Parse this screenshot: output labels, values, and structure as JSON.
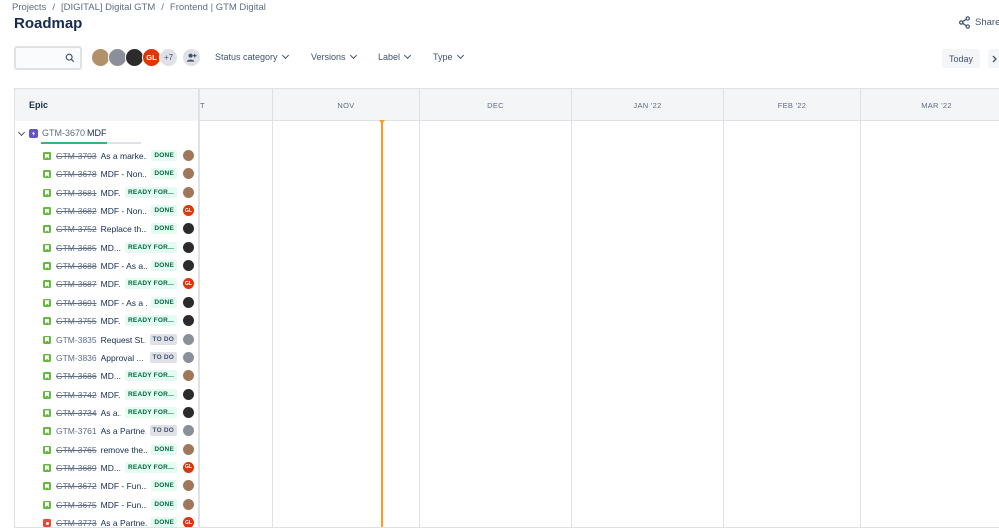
{
  "breadcrumb": {
    "items": [
      "Projects",
      "[DIGITAL] Digital GTM",
      "Frontend | GTM Digital"
    ],
    "separator": "/"
  },
  "page": {
    "title": "Roadmap",
    "share_label": "Share"
  },
  "toolbar": {
    "search_placeholder": "",
    "more_avatars_label": "+7",
    "filters": [
      "Status category",
      "Versions",
      "Label",
      "Type"
    ],
    "today_label": "Today"
  },
  "avatars": [
    {
      "initials": "",
      "color": "#b0916a"
    },
    {
      "initials": "",
      "color": "#8a8f99"
    },
    {
      "initials": "",
      "color": "#2b2b2b"
    },
    {
      "initials": "GL",
      "color": "#de350b"
    }
  ],
  "timeline": {
    "epic_column_label": "Epic",
    "months": [
      "T",
      "NOV",
      "DEC",
      "JAN '22",
      "FEB '22",
      "MAR '22"
    ]
  },
  "epic": {
    "key": "GTM-3670",
    "name": "MDF",
    "progress": 0.66
  },
  "colors": {
    "done_avatar": "#a1887f",
    "today_line": "#ff991f"
  },
  "issues": [
    {
      "key": "GTM-3703",
      "summary": "As a marke...",
      "status": "DONE",
      "type": "story",
      "avatar": "#a1775b",
      "av_text": ""
    },
    {
      "key": "GTM-3678",
      "summary": "MDF - Non...",
      "status": "DONE",
      "type": "story",
      "avatar": "#a1775b",
      "av_text": ""
    },
    {
      "key": "GTM-3681",
      "summary": "MDF...",
      "status": "READY FOR...",
      "type": "story",
      "avatar": "#a1775b",
      "av_text": ""
    },
    {
      "key": "GTM-3682",
      "summary": "MDF - Non...",
      "status": "DONE",
      "type": "story",
      "avatar": "#de350b",
      "av_text": "GL"
    },
    {
      "key": "GTM-3752",
      "summary": "Replace th...",
      "status": "DONE",
      "type": "story",
      "avatar": "#2b2b2b",
      "av_text": ""
    },
    {
      "key": "GTM-3685",
      "summary": "MD...",
      "status": "READY FOR...",
      "type": "story",
      "avatar": "#2b2b2b",
      "av_text": ""
    },
    {
      "key": "GTM-3688",
      "summary": "MDF - As a...",
      "status": "DONE",
      "type": "story",
      "avatar": "#2b2b2b",
      "av_text": ""
    },
    {
      "key": "GTM-3687",
      "summary": "MDF...",
      "status": "READY FOR...",
      "type": "story",
      "avatar": "#de350b",
      "av_text": "GL"
    },
    {
      "key": "GTM-3691",
      "summary": "MDF - As a ...",
      "status": "DONE",
      "type": "story",
      "avatar": "#2b2b2b",
      "av_text": ""
    },
    {
      "key": "GTM-3755",
      "summary": "MDF...",
      "status": "READY FOR...",
      "type": "story",
      "avatar": "#2b2b2b",
      "av_text": ""
    },
    {
      "key": "GTM-3835",
      "summary": "Request St...",
      "status": "TO DO",
      "type": "story",
      "avatar": "#8a8f99",
      "av_text": ""
    },
    {
      "key": "GTM-3836",
      "summary": "Approval ...",
      "status": "TO DO",
      "type": "story",
      "avatar": "#8a8f99",
      "av_text": ""
    },
    {
      "key": "GTM-3686",
      "summary": "MD...",
      "status": "READY FOR...",
      "type": "story",
      "avatar": "#a1775b",
      "av_text": ""
    },
    {
      "key": "GTM-3742",
      "summary": "MDF...",
      "status": "READY FOR...",
      "type": "story",
      "avatar": "#2b2b2b",
      "av_text": ""
    },
    {
      "key": "GTM-3734",
      "summary": "As a...",
      "status": "READY FOR...",
      "type": "story",
      "avatar": "#2b2b2b",
      "av_text": ""
    },
    {
      "key": "GTM-3761",
      "summary": "As a Partne...",
      "status": "TO DO",
      "type": "story",
      "avatar": "#8a8f99",
      "av_text": ""
    },
    {
      "key": "GTM-3765",
      "summary": "remove the...",
      "status": "DONE",
      "type": "story",
      "avatar": "#a1775b",
      "av_text": ""
    },
    {
      "key": "GTM-3689",
      "summary": "MD...",
      "status": "READY FOR...",
      "type": "story",
      "avatar": "#de350b",
      "av_text": "GL"
    },
    {
      "key": "GTM-3672",
      "summary": "MDF - Fun...",
      "status": "DONE",
      "type": "story",
      "avatar": "#a1775b",
      "av_text": ""
    },
    {
      "key": "GTM-3675",
      "summary": "MDF - Fun...",
      "status": "DONE",
      "type": "story",
      "avatar": "#a1775b",
      "av_text": ""
    },
    {
      "key": "GTM-3773",
      "summary": "As a Partne...",
      "status": "DONE",
      "type": "bug",
      "avatar": "#de350b",
      "av_text": "GL"
    }
  ]
}
